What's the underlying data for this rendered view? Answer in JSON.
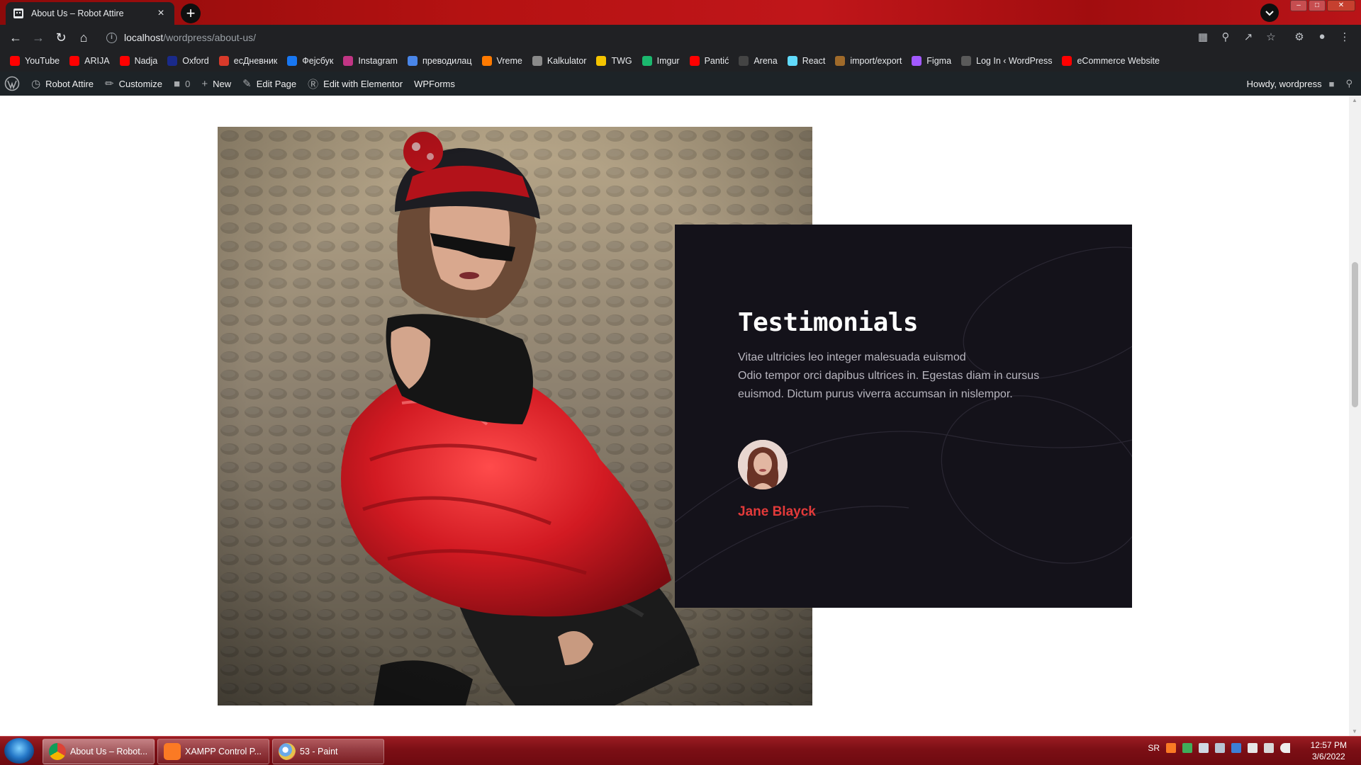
{
  "browser": {
    "tab_title": "About Us – Robot Attire",
    "tab_close": "×",
    "new_tab": "+",
    "url_host": "localhost",
    "url_path": "/wordpress/about-us/",
    "bookmarks": [
      "YouTube",
      "ARIJA",
      "Nadja",
      "Oxford",
      "есДневник",
      "Фејсбук",
      "Instagram",
      "преводилац",
      "Vreme",
      "Kalkulator",
      "TWG",
      "Imgur",
      "Pantić",
      "Arena",
      "React",
      "import/export",
      "Figma",
      "Log In ‹ WordPress",
      "eCommerce Website"
    ],
    "bookmark_colors": [
      "#ff0000",
      "#ff0000",
      "#ff0000",
      "#1a2a8a",
      "#d83a2a",
      "#1877f2",
      "#c13584",
      "#4a86e8",
      "#ff7a00",
      "#8a8a8a",
      "#f5c400",
      "#1bb76e",
      "#ff0000",
      "#444444",
      "#61dafb",
      "#a06a2a",
      "#a259ff",
      "#5a5a5a",
      "#ff0000"
    ]
  },
  "adminbar": {
    "site_name": "Robot Attire",
    "customize": "Customize",
    "comments_count": "0",
    "new": "New",
    "edit_page": "Edit Page",
    "edit_elementor": "Edit with Elementor",
    "wpforms": "WPForms",
    "howdy": "Howdy, wordpress"
  },
  "testimonial": {
    "heading": "Testimonials",
    "quote_line1": "Vitae ultricies leo integer malesuada euismod",
    "quote_line2": "Odio tempor orci dapibus ultrices in. Egestas diam in cursus euismod. Dictum purus viverra accumsan in nislempor.",
    "author": "Jane Blayck",
    "accent_color": "#e23a3a",
    "card_color": "#14121a"
  },
  "taskbar": {
    "tasks": [
      "About Us – Robot...",
      "XAMPP Control P...",
      "53 - Paint"
    ],
    "lang": "SR",
    "time": "12:57 PM",
    "date": "3/6/2022"
  }
}
